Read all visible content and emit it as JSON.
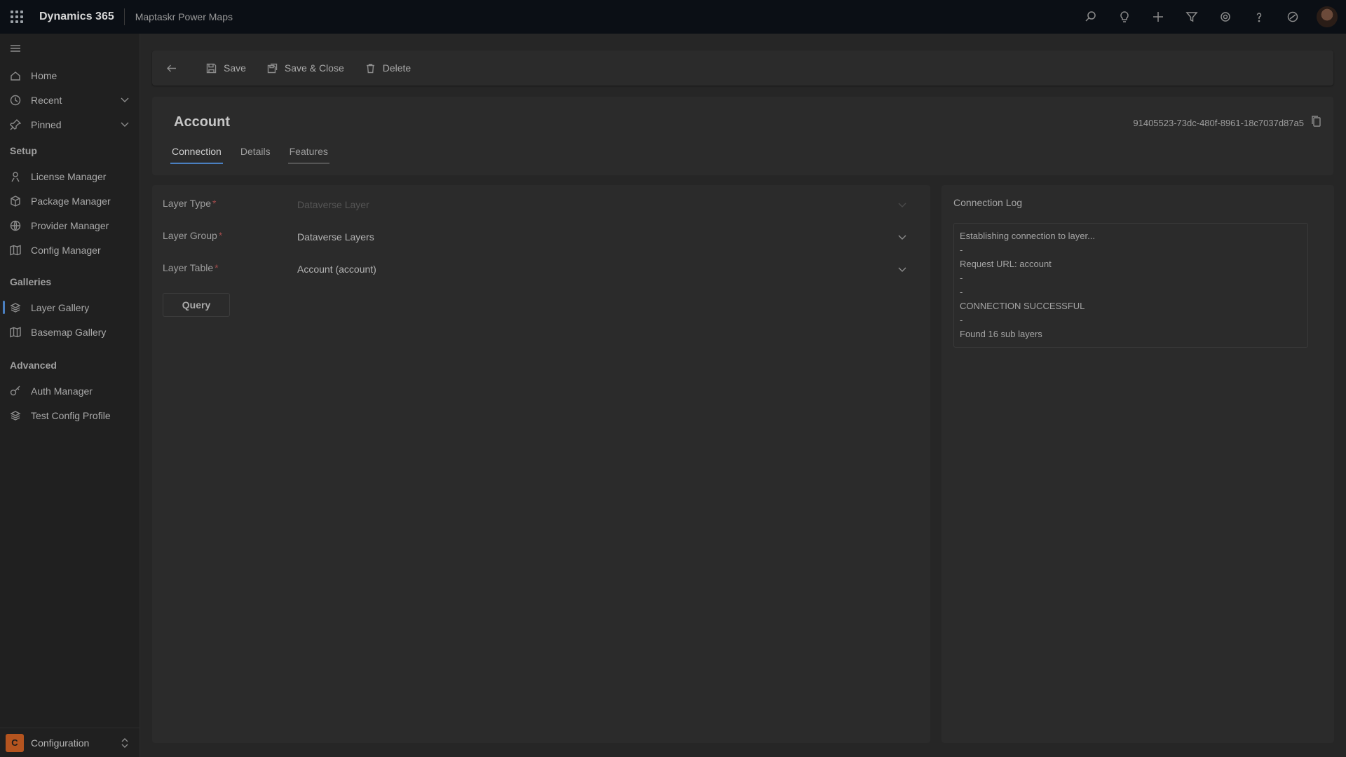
{
  "topbar": {
    "app_name": "Dynamics 365",
    "app_subtitle": "Maptaskr Power Maps",
    "icons": [
      "search-icon",
      "lightbulb-icon",
      "plus-icon",
      "filter-icon",
      "settings-icon",
      "help-icon",
      "copilot-icon"
    ]
  },
  "sidebar": {
    "items": [
      {
        "label": "Home",
        "icon": "home-icon"
      },
      {
        "label": "Recent",
        "icon": "clock-icon"
      },
      {
        "label": "Pinned",
        "icon": "pin-icon"
      }
    ],
    "sections": [
      {
        "title": "Setup",
        "items": [
          {
            "label": "License Manager",
            "icon": "license-icon"
          },
          {
            "label": "Package Manager",
            "icon": "package-icon"
          },
          {
            "label": "Provider Manager",
            "icon": "globe-icon"
          },
          {
            "label": "Config Manager",
            "icon": "map-icon"
          }
        ]
      },
      {
        "title": "Galleries",
        "items": [
          {
            "label": "Layer Gallery",
            "icon": "layers-icon",
            "active": true
          },
          {
            "label": "Basemap Gallery",
            "icon": "map-icon"
          }
        ]
      },
      {
        "title": "Advanced",
        "items": [
          {
            "label": "Auth Manager",
            "icon": "key-icon"
          },
          {
            "label": "Test Config Profile",
            "icon": "layers-icon"
          }
        ]
      }
    ],
    "area": {
      "badge": "C",
      "label": "Configuration"
    }
  },
  "commandbar": {
    "save": "Save",
    "save_close": "Save & Close",
    "delete": "Delete"
  },
  "header": {
    "title": "Account",
    "record_id": "91405523-73dc-480f-8961-18c7037d87a5",
    "tabs": [
      "Connection",
      "Details",
      "Features"
    ],
    "active_tab": "Connection"
  },
  "form": {
    "fields": [
      {
        "label": "Layer Type",
        "required": "*",
        "value": "Dataverse Layer"
      },
      {
        "label": "Layer Group",
        "required": "*",
        "value": "Dataverse Layers"
      },
      {
        "label": "Layer Table",
        "required": "*",
        "value": "Account (account)"
      }
    ],
    "query_button": "Query"
  },
  "log": {
    "title": "Connection Log",
    "lines": [
      "Establishing connection to layer...",
      "-",
      "Request URL: account",
      "-",
      "-",
      "CONNECTION SUCCESSFUL",
      "-",
      "Found 16 sub layers"
    ]
  },
  "colors": {
    "accent": "#4a7fc0",
    "topbar_bg": "#0b0f15",
    "area_badge": "#b4541f"
  }
}
